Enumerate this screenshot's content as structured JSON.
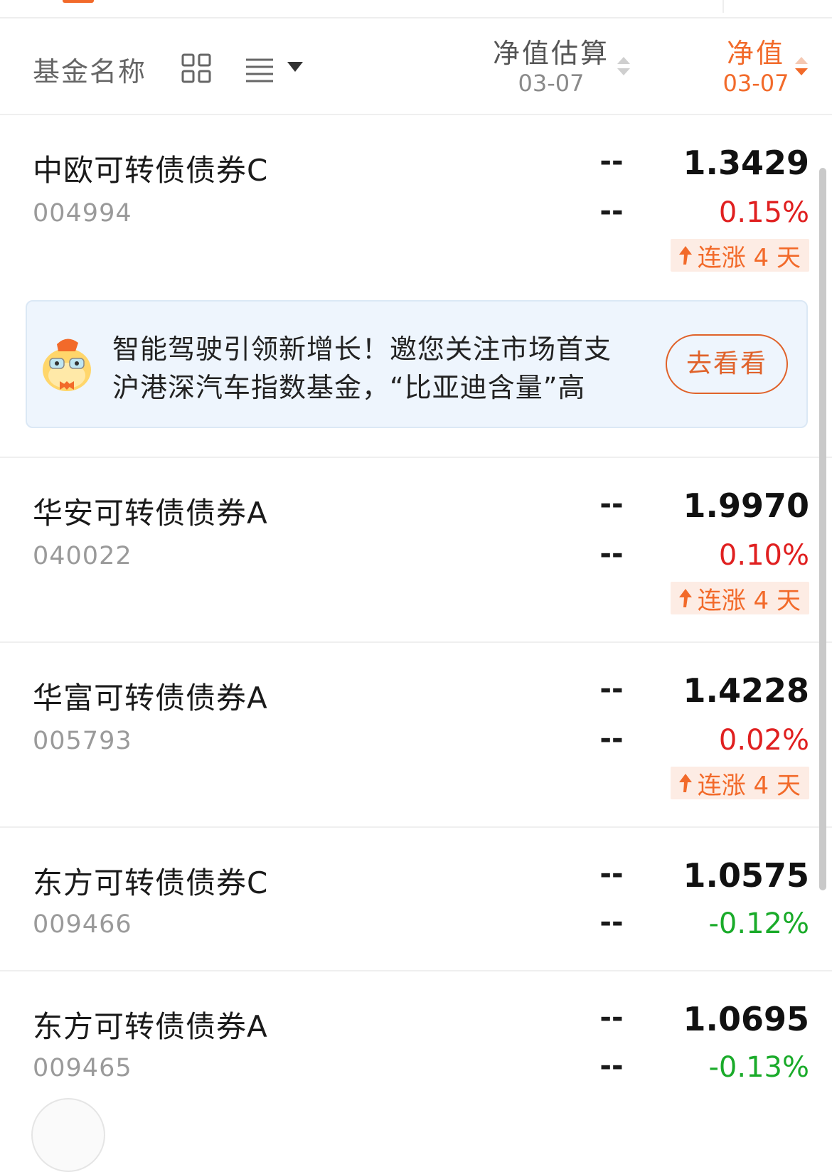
{
  "header": {
    "col_name": "基金名称",
    "col_est_label": "净值估算",
    "col_est_date": "03-07",
    "col_nav_label": "净值",
    "col_nav_date": "03-07",
    "active_color": "#f26a2a"
  },
  "funds": [
    {
      "name": "中欧可转债债券C",
      "code": "004994",
      "est": "--",
      "est_change": "--",
      "nav": "1.3429",
      "change": "0.15%",
      "direction": "up",
      "streak": "连涨 4 天"
    },
    {
      "name": "华安可转债债券A",
      "code": "040022",
      "est": "--",
      "est_change": "--",
      "nav": "1.9970",
      "change": "0.10%",
      "direction": "up",
      "streak": "连涨 4 天"
    },
    {
      "name": "华富可转债债券A",
      "code": "005793",
      "est": "--",
      "est_change": "--",
      "nav": "1.4228",
      "change": "0.02%",
      "direction": "up",
      "streak": "连涨 4 天"
    },
    {
      "name": "东方可转债债券C",
      "code": "009466",
      "est": "--",
      "est_change": "--",
      "nav": "1.0575",
      "change": "-0.12%",
      "direction": "down"
    },
    {
      "name": "东方可转债债券A",
      "code": "009465",
      "est": "--",
      "est_change": "--",
      "nav": "1.0695",
      "change": "-0.13%",
      "direction": "down"
    }
  ],
  "banner": {
    "line1": "智能驾驶引领新增长！邀您关注市场首支",
    "line2": "沪港深汽车指数基金，“比亚迪含量”高",
    "button": "去看看"
  },
  "colors": {
    "up": "#e02020",
    "down": "#1aab2a",
    "accent": "#f26a2a"
  }
}
